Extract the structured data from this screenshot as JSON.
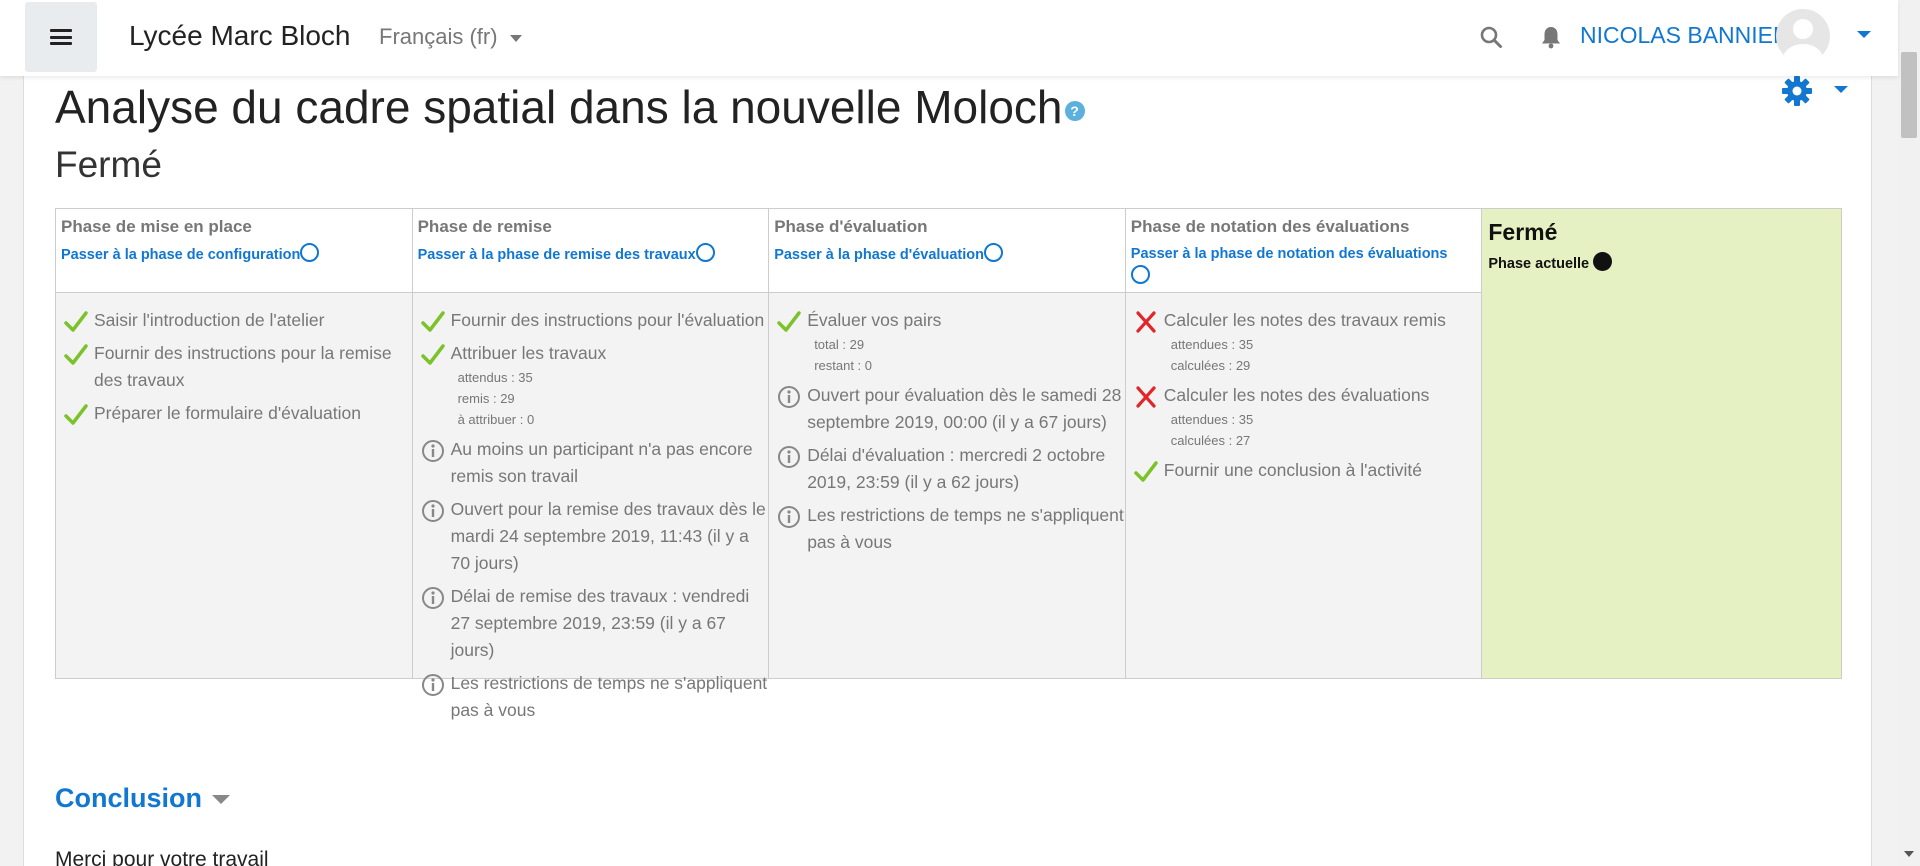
{
  "navbar": {
    "site_name": "Lycée Marc Bloch",
    "language": "Français (fr)",
    "user_name": "NICOLAS BANNIER",
    "icons": [
      "menu-icon",
      "search-icon",
      "bell-icon",
      "avatar",
      "chevron-down-icon"
    ]
  },
  "page": {
    "title": "Analyse du cadre spatial dans la nouvelle Moloch",
    "help_icon_label": "?",
    "subtitle": "Fermé",
    "settings_icon": "gear-icon"
  },
  "phases": {
    "setup": {
      "title": "Phase de mise en place",
      "link": "Passer à la phase de configuration",
      "tasks": [
        {
          "icon": "check-icon",
          "text": "Saisir l'introduction de l'atelier"
        },
        {
          "icon": "check-icon",
          "text": "Fournir des instructions pour la remise des travaux"
        },
        {
          "icon": "check-icon",
          "text": "Préparer le formulaire d'évaluation"
        }
      ]
    },
    "submission": {
      "title": "Phase de remise",
      "link": "Passer à la phase de remise des travaux",
      "tasks": [
        {
          "icon": "check-icon",
          "text": "Fournir des instructions pour l'évaluation"
        },
        {
          "icon": "check-icon",
          "text": "Attribuer les travaux",
          "details": [
            "attendus : 35",
            "remis : 29",
            "à attribuer : 0"
          ]
        },
        {
          "icon": "info-icon",
          "text": "Au moins un participant n'a pas encore remis son travail"
        },
        {
          "icon": "info-icon",
          "text": "Ouvert pour la remise des travaux dès le mardi 24 septembre 2019, 11:43 (il y a 70 jours)"
        },
        {
          "icon": "info-icon",
          "text": "Délai de remise des travaux : vendredi 27 septembre 2019, 23:59 (il y a 67 jours)"
        },
        {
          "icon": "info-icon",
          "text": "Les restrictions de temps ne s'appliquent pas à vous"
        }
      ]
    },
    "assessment": {
      "title": "Phase d'évaluation",
      "link": "Passer à la phase d'évaluation",
      "tasks": [
        {
          "icon": "check-icon",
          "text": "Évaluer vos pairs",
          "details": [
            "total : 29",
            "restant : 0"
          ]
        },
        {
          "icon": "info-icon",
          "text": "Ouvert pour évaluation dès le samedi 28 septembre 2019, 00:00 (il y a 67 jours)"
        },
        {
          "icon": "info-icon",
          "text": "Délai d'évaluation : mercredi 2 octobre 2019, 23:59 (il y a 62 jours)"
        },
        {
          "icon": "info-icon",
          "text": "Les restrictions de temps ne s'appliquent pas à vous"
        }
      ]
    },
    "grading": {
      "title": "Phase de notation des évaluations",
      "link": "Passer à la phase de notation des évaluations",
      "tasks": [
        {
          "icon": "cross-icon",
          "text": "Calculer les notes des travaux remis",
          "details": [
            "attendues : 35",
            "calculées : 29"
          ]
        },
        {
          "icon": "cross-icon",
          "text": "Calculer les notes des évaluations",
          "details": [
            "attendues : 35",
            "calculées : 27"
          ]
        },
        {
          "icon": "check-icon",
          "text": "Fournir une conclusion à l'activité"
        }
      ]
    },
    "closed": {
      "title": "Fermé",
      "current_label": "Phase actuelle"
    }
  },
  "conclusion": {
    "heading": "Conclusion",
    "text": "Merci pour votre travail"
  },
  "colors": {
    "link": "#1177d1",
    "check": "#7cc22a",
    "cross": "#e0262b",
    "current_phase_bg": "#e5f0c3"
  }
}
